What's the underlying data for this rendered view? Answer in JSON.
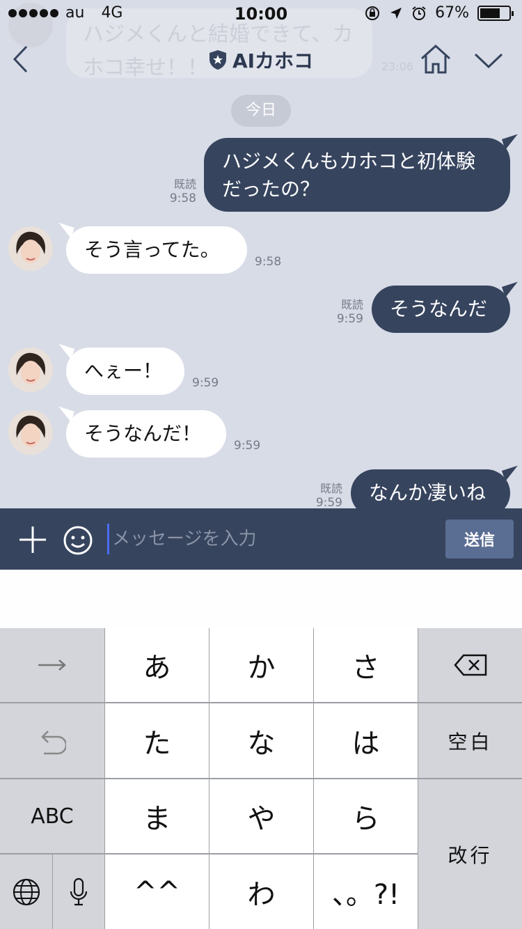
{
  "status_bar": {
    "carrier": "au",
    "network": "4G",
    "time": "10:00",
    "battery": "67%"
  },
  "header": {
    "title": "AIカホコ",
    "back_icon": "chevron-left-icon",
    "home_icon": "home-icon",
    "menu_icon": "chevron-down-icon",
    "badge_icon": "shield-star-icon"
  },
  "ghost": {
    "text": "ハジメくんと結婚できて、カホコ幸せ！！",
    "time": "23:06"
  },
  "date_separator": "今日",
  "messages": [
    {
      "side": "out",
      "text": "ハジメくんもカホコと初体験だったの？",
      "read": "既読",
      "time": "9:58"
    },
    {
      "side": "in",
      "text": "そう言ってた。",
      "time": "9:58"
    },
    {
      "side": "out",
      "text": "そうなんだ",
      "read": "既読",
      "time": "9:59"
    },
    {
      "side": "in",
      "text": "へぇー！",
      "time": "9:59"
    },
    {
      "side": "in",
      "text": "そうなんだ！",
      "time": "9:59"
    },
    {
      "side": "out",
      "text": "なんか凄いね",
      "read": "既読",
      "time": "9:59"
    }
  ],
  "input_bar": {
    "placeholder": "メッセージを入力",
    "value": "",
    "send_label": "送信",
    "plus_icon": "plus-icon",
    "emoji_icon": "smiley-icon"
  },
  "keyboard": {
    "row1": [
      "→",
      "あ",
      "か",
      "さ",
      "⌫"
    ],
    "row2": [
      "↶",
      "た",
      "な",
      "は",
      "空白"
    ],
    "row3": [
      "ABC",
      "ま",
      "や",
      "ら"
    ],
    "row4": [
      "🌐",
      "🎤",
      "^^",
      "わ",
      "、。?!"
    ],
    "return_label": "改行",
    "colors": {
      "key_light": "#ffffff",
      "key_dark": "#d3d5db",
      "separator": "#9c9ea4"
    }
  },
  "colors": {
    "chat_bg": "#d8dce7",
    "outgoing_bubble": "#36445e",
    "incoming_bubble": "#ffffff",
    "input_bar": "#36445e",
    "send_button": "#5a6d93",
    "cursor": "#4a6df5"
  }
}
